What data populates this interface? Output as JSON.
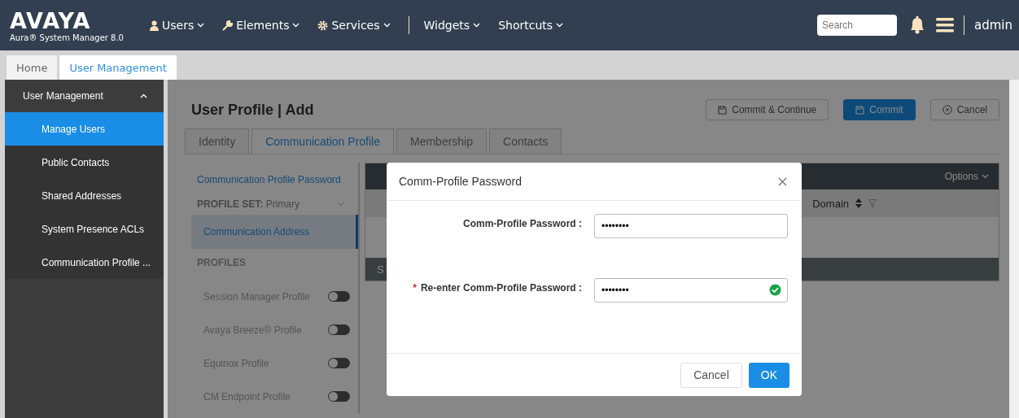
{
  "header": {
    "logo": "AVAYA",
    "subtitle": "Aura® System Manager 8.0",
    "nav": [
      {
        "label": "Users",
        "kind": "user"
      },
      {
        "label": "Elements",
        "kind": "wrench"
      },
      {
        "label": "Services",
        "kind": "gear"
      },
      {
        "label": "Widgets",
        "kind": "plain"
      },
      {
        "label": "Shortcuts",
        "kind": "plain"
      }
    ],
    "search": {
      "placeholder": "Search"
    },
    "user": "admin"
  },
  "tabs": [
    {
      "label": "Home",
      "selected": false
    },
    {
      "label": "User Management",
      "selected": true
    }
  ],
  "sidebar": {
    "title": "User Management",
    "expanded": true,
    "items": [
      {
        "label": "Manage Users",
        "selected": true
      },
      {
        "label": "Public Contacts",
        "selected": false
      },
      {
        "label": "Shared Addresses",
        "selected": false
      },
      {
        "label": "System Presence ACLs",
        "selected": false
      },
      {
        "label": "Communication Profile ...",
        "selected": false
      }
    ]
  },
  "page": {
    "title": "User Profile | Add",
    "buttons": [
      {
        "label": "Commit & Continue",
        "kind": "save",
        "primary": false
      },
      {
        "label": "Commit",
        "kind": "save",
        "primary": true
      },
      {
        "label": "Cancel",
        "kind": "cancel",
        "primary": false
      }
    ],
    "tabs": [
      {
        "label": "Identity",
        "selected": false
      },
      {
        "label": "Communication Profile",
        "selected": true
      },
      {
        "label": "Membership",
        "selected": false
      },
      {
        "label": "Contacts",
        "selected": false
      }
    ],
    "side": {
      "password_link": "Communication Profile Password",
      "profile_set_label": "PROFILE SET:",
      "profile_set_value": "Primary",
      "address_item": "Communication Address",
      "profiles_heading": "PROFILES",
      "profiles": [
        {
          "label": "Session Manager Profile",
          "on": false
        },
        {
          "label": "Avaya Breeze® Profile",
          "on": false
        },
        {
          "label": "Equinox Profile",
          "on": false
        },
        {
          "label": "CM Endpoint Profile",
          "on": false
        }
      ]
    },
    "table": {
      "options": "Options",
      "column": "Domain",
      "footer": "S"
    }
  },
  "dialog": {
    "title": "Comm-Profile Password",
    "fields": [
      {
        "label": "Comm-Profile Password :",
        "value": "••••••••",
        "valid": false
      },
      {
        "label": "Re-enter Comm-Profile Password :",
        "value": "••••••••",
        "required_mark": "*",
        "valid": true
      }
    ],
    "cancel": "Cancel",
    "ok": "OK"
  }
}
